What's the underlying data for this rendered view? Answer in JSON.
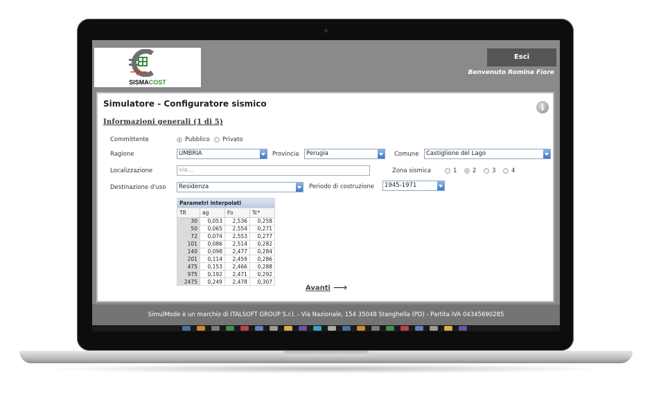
{
  "header": {
    "logo_text_main": "SISMA",
    "logo_text_accent": "COST",
    "logout_label": "Esci",
    "welcome_text": "Benvenuto Romina Fiore"
  },
  "page": {
    "title": "Simulatore - Configuratore sismico",
    "section": "Informazioni generali (1 di 5)"
  },
  "form": {
    "committente_label": "Committente",
    "committente_options": [
      "Pubblico",
      "Privato"
    ],
    "committente_selected": "Pubblico",
    "ragione_label": "Ragione",
    "ragione_value": "UMBRIA",
    "provincia_label": "Provincia",
    "provincia_value": "Perugia",
    "comune_label": "Comune",
    "comune_value": "Castiglione del Lago",
    "localizzazione_label": "Localizzazione",
    "localizzazione_placeholder": "via...",
    "zona_label": "Zona sismica",
    "zona_options": [
      "1",
      "2",
      "3",
      "4"
    ],
    "zona_selected": "2",
    "destinazione_label": "Destinazione d'uso",
    "destinazione_value": "Residenza",
    "periodo_label": "Periodo di costruzione",
    "periodo_value": "1945-1971"
  },
  "parametri": {
    "caption": "Parametri interpolati",
    "columns": [
      "TR",
      "ag",
      "Fo",
      "Tc*"
    ],
    "rows": [
      [
        "30",
        "0,053",
        "2,536",
        "0,258"
      ],
      [
        "50",
        "0,065",
        "2,554",
        "0,271"
      ],
      [
        "72",
        "0,074",
        "2,553",
        "0,277"
      ],
      [
        "101",
        "0,086",
        "2,514",
        "0,282"
      ],
      [
        "140",
        "0,098",
        "2,477",
        "0,284"
      ],
      [
        "201",
        "0,114",
        "2,459",
        "0,286"
      ],
      [
        "475",
        "0,153",
        "2,466",
        "0,288"
      ],
      [
        "975",
        "0,192",
        "2,471",
        "0,292"
      ],
      [
        "2475",
        "0,249",
        "2,478",
        "0,307"
      ]
    ]
  },
  "nav": {
    "next_label": "Avanti"
  },
  "footer": {
    "text": "SimulMode è un marchio di ITALSOFT GROUP S.r.l. - Via Nazionale, 154 35048 Stanghella (PD) - Partita IVA 04345690285"
  },
  "colors": {
    "header_bg": "#8a8a8a",
    "footer_bg": "#747474",
    "select_arrow": "#3f78c4",
    "logo_accent": "#3a8a3a"
  }
}
